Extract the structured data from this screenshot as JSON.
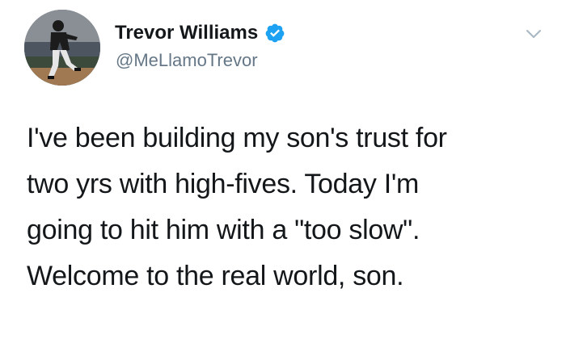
{
  "tweet": {
    "author": {
      "display_name": "Trevor Williams",
      "handle": "@MeLlamoTrevor",
      "verified": true,
      "avatar_icon": "baseball-player-avatar"
    },
    "menu_icon": "chevron-down-icon",
    "text_lines": [
      "I've been building my son's trust for",
      "two yrs with high-fives. Today I'm",
      "going to hit him with a \"too slow\".",
      "Welcome to the real world, son."
    ]
  },
  "colors": {
    "text": "#14171a",
    "handle": "#657786",
    "verified_blue": "#1da1f2",
    "caret": "#aab8c2"
  }
}
